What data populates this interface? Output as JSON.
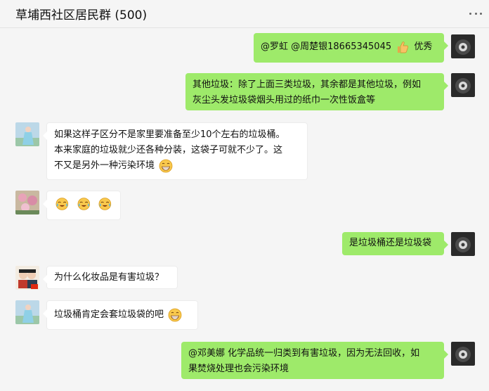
{
  "header": {
    "title": "草埔西社区居民群 (500)",
    "more_icon": "more-dots-icon"
  },
  "messages": [
    {
      "side": "right",
      "mention_text": "@罗虹 @周楚银18665345045",
      "emoji": "thumbs-up-icon",
      "tail_text": "优秀"
    },
    {
      "side": "right",
      "lines": [
        "其他垃圾：除了上面三类垃圾，其余都是其他垃圾，例如",
        "灰尘头发垃圾袋烟头用过的纸巾一次性饭盒等"
      ]
    },
    {
      "side": "left",
      "lines": [
        "如果这样子区分不是家里要准备至少10个左右的垃圾桶。",
        "本来家庭的垃圾就少还各种分装，这袋子可就不少了。这",
        "不又是另外一种污染环境"
      ],
      "emoji": "grin-face-icon"
    },
    {
      "side": "left",
      "emojis": [
        "crying-laugh-icon",
        "crying-laugh-icon",
        "crying-laugh-icon"
      ]
    },
    {
      "side": "right",
      "text": "是垃圾桶还是垃圾袋"
    },
    {
      "side": "left",
      "text": "为什么化妆品是有害垃圾？"
    },
    {
      "side": "left",
      "text": "垃圾桶肯定会套垃圾袋的吧",
      "emoji": "grin-face-icon"
    },
    {
      "side": "right",
      "lines": [
        "@邓美娜 化学品统一归类到有害垃圾，因为无法回收，如",
        "果焚烧处理也会污染环境"
      ]
    }
  ],
  "colors": {
    "self_bubble": "#9eea6a",
    "other_bubble": "#ffffff",
    "background": "#f5f5f5"
  }
}
